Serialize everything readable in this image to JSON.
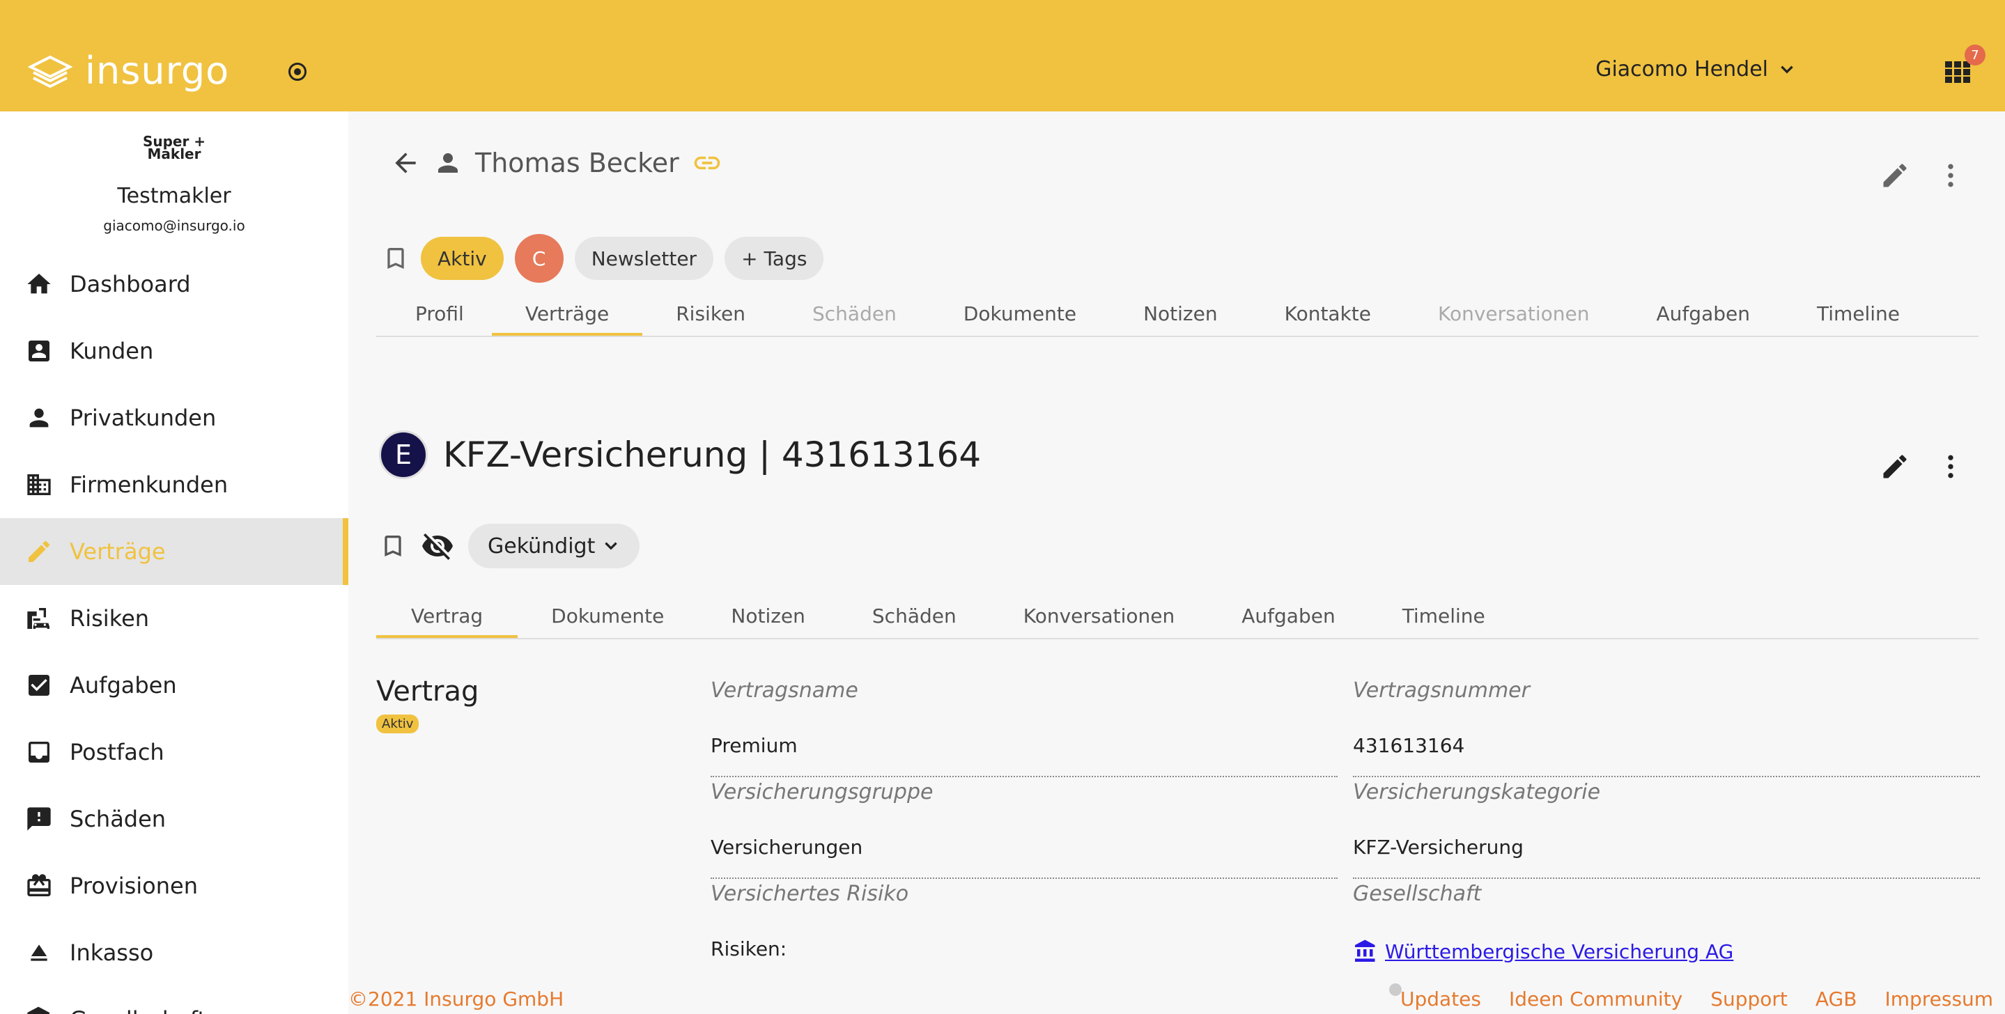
{
  "app": {
    "logo_text": "insurgo",
    "user_name": "Giacomo Hendel",
    "notification_count": "7"
  },
  "sidebar": {
    "brand_logo_text": "Super + Makler",
    "broker_name": "Testmakler",
    "broker_email": "giacomo@insurgo.io",
    "items": [
      {
        "label": "Dashboard",
        "icon": "home-icon"
      },
      {
        "label": "Kunden",
        "icon": "contact-card-icon"
      },
      {
        "label": "Privatkunden",
        "icon": "person-icon"
      },
      {
        "label": "Firmenkunden",
        "icon": "building-icon"
      },
      {
        "label": "Verträge",
        "icon": "pencil-icon",
        "active": true
      },
      {
        "label": "Risiken",
        "icon": "risk-building-car-icon"
      },
      {
        "label": "Aufgaben",
        "icon": "checkbox-icon"
      },
      {
        "label": "Postfach",
        "icon": "inbox-icon"
      },
      {
        "label": "Schäden",
        "icon": "feedback-icon"
      },
      {
        "label": "Provisionen",
        "icon": "gift-icon"
      },
      {
        "label": "Inkasso",
        "icon": "eject-icon"
      },
      {
        "label": "Gesellschaften",
        "icon": "bank-icon"
      }
    ]
  },
  "customer": {
    "name": "Thomas Becker",
    "chips": {
      "status": "Aktiv",
      "initial": "C",
      "newsletter": "Newsletter",
      "add_tags": "+ Tags"
    },
    "tabs": [
      "Profil",
      "Verträge",
      "Risiken",
      "Schäden",
      "Dokumente",
      "Notizen",
      "Kontakte",
      "Konversationen",
      "Aufgaben",
      "Timeline"
    ]
  },
  "contract": {
    "badge_letter": "E",
    "title": "KFZ-Versicherung | 431613164",
    "status_select": "Gekündigt",
    "tabs": [
      "Vertrag",
      "Dokumente",
      "Notizen",
      "Schäden",
      "Konversationen",
      "Aufgaben",
      "Timeline"
    ],
    "section_title": "Vertrag",
    "section_badge": "Aktiv",
    "fields": {
      "vertragsname_label": "Vertragsname",
      "vertragsname_value": "Premium",
      "vertragsnummer_label": "Vertragsnummer",
      "vertragsnummer_value": "431613164",
      "versicherungsgruppe_label": "Versicherungsgruppe",
      "versicherungsgruppe_value": "Versicherungen",
      "versicherungskategorie_label": "Versicherungskategorie",
      "versicherungskategorie_value": "KFZ-Versicherung",
      "versichertes_risiko_label": "Versichertes Risiko",
      "versichertes_risiko_value": "Risiken:",
      "gesellschaft_label": "Gesellschaft",
      "gesellschaft_value": "Württembergische Versicherung AG"
    }
  },
  "footer": {
    "copyright": "©2021 Insurgo GmbH",
    "links": [
      "Updates",
      "Ideen Community",
      "Support",
      "AGB",
      "Impressum"
    ]
  },
  "colors": {
    "brand_yellow": "#f0c240",
    "accent_orange": "#e67a2e",
    "link_blue": "#2b1ae6",
    "badge_red": "#e46a4b"
  }
}
